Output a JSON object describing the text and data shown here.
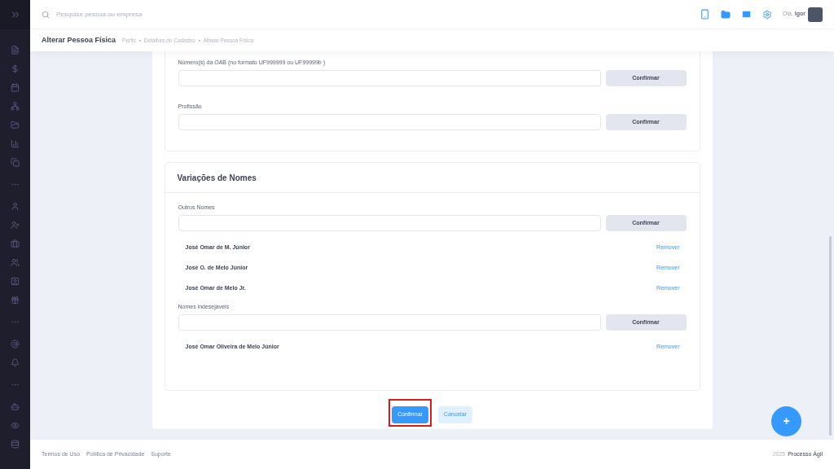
{
  "topbar": {
    "search": {
      "placeholder": "Pesquise pessoa ou empresa"
    },
    "greeting": "Olá,",
    "user_name": "Igor"
  },
  "subheader": {
    "title": "Alterar Pessoa Física",
    "breadcrumbs": [
      "Perfis",
      "Detalhes do Cadastro",
      "Alterar Pessoa Física"
    ]
  },
  "sections": [
    {
      "fields": [
        {
          "label": "Número(s) da OAB (no formato UF999999 ou UF99999b )",
          "button": "Confirmar"
        },
        {
          "label": "Profissão",
          "button": "Confirmar"
        }
      ]
    },
    {
      "title": "Variações de Nomes",
      "fields": [
        {
          "label": "Outros Nomes",
          "button": "Confirmar",
          "entries": [
            {
              "name": "José Omar de M. Júnior",
              "action": "Remover"
            },
            {
              "name": "José O. de Melo Júnior",
              "action": "Remover"
            },
            {
              "name": "José Omar de Melo Jr.",
              "action": "Remover"
            }
          ]
        },
        {
          "label": "Nomes indesejáveis",
          "button": "Confirmar",
          "entries": [
            {
              "name": "José Omar Oliveira de Melo Júnior",
              "action": "Remover"
            }
          ]
        }
      ]
    }
  ],
  "actions": [
    {
      "label": "Confirmar",
      "kind": "primary",
      "highlighted": true
    },
    {
      "label": "Cancelar",
      "kind": "secondary",
      "highlighted": false
    }
  ],
  "fab": {
    "label": "+"
  },
  "footer": {
    "links": [
      "Termos de Uso",
      "Política de Privacidade",
      "Suporte"
    ],
    "year": "2025",
    "brand": "Processo Ágil"
  }
}
